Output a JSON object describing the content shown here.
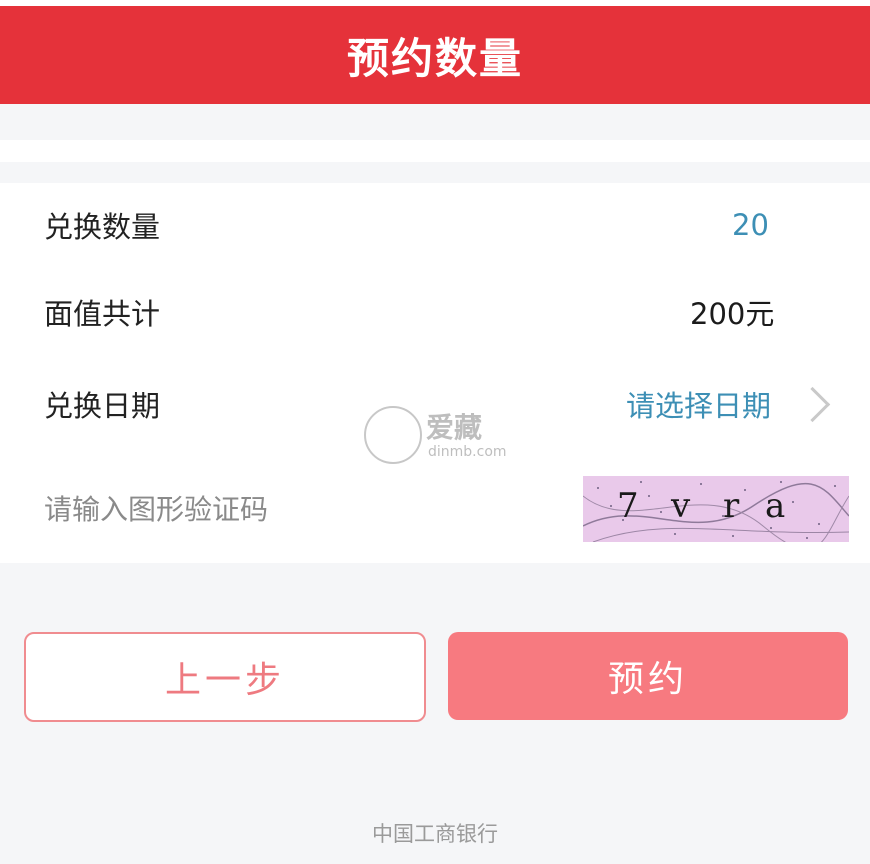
{
  "header": {
    "title": "预约数量"
  },
  "form": {
    "quantity": {
      "label": "兑换数量",
      "value": "20"
    },
    "face_value": {
      "label": "面值共计",
      "value": "200元"
    },
    "date": {
      "label": "兑换日期",
      "placeholder": "请选择日期",
      "chevron_icon": "chevron-right-icon"
    },
    "captcha": {
      "placeholder": "请输入图形验证码",
      "image_text": [
        "7",
        "v",
        "r",
        "a"
      ]
    }
  },
  "watermark": {
    "text": "爱藏",
    "url": "dinmb.com"
  },
  "buttons": {
    "back_label": "上一步",
    "submit_label": "预约"
  },
  "footer": {
    "bank_name": "中国工商银行"
  },
  "colors": {
    "header_red": "#e5323a",
    "value_blue": "#3d8fb5",
    "submit_pink": "#f77a80",
    "back_border": "#f08c90",
    "captcha_bg": "#e9c9ea"
  }
}
